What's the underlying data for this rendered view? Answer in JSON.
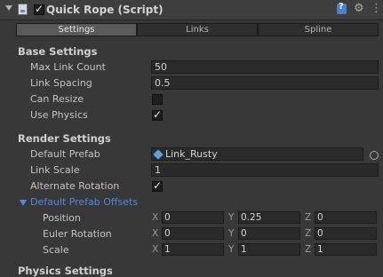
{
  "header": {
    "title": "Quick Rope (Script)",
    "enabled": true,
    "icons": [
      "script-icon",
      "help-book-icon",
      "gear-icon",
      "menu-icon"
    ]
  },
  "tabs": [
    {
      "label": "Settings",
      "active": true
    },
    {
      "label": "Links"
    },
    {
      "label": "Spline"
    }
  ],
  "base_settings": {
    "title": "Base Settings",
    "max_link_count": {
      "label": "Max Link Count",
      "value": "50"
    },
    "link_spacing": {
      "label": "Link Spacing",
      "value": "0.5"
    },
    "can_resize": {
      "label": "Can Resize",
      "checked": false
    },
    "use_physics": {
      "label": "Use Physics",
      "checked": true
    }
  },
  "render_settings": {
    "title": "Render Settings",
    "default_prefab": {
      "label": "Default Prefab",
      "value": "Link_Rusty"
    },
    "link_scale": {
      "label": "Link Scale",
      "value": "1"
    },
    "alternate_rotation": {
      "label": "Alternate Rotation",
      "checked": true
    },
    "offsets": {
      "title": "Default Prefab Offsets",
      "position": {
        "label": "Position",
        "x": "0",
        "y": "0.25",
        "z": "0"
      },
      "euler_rotation": {
        "label": "Euler Rotation",
        "x": "0",
        "y": "0",
        "z": "0"
      },
      "scale": {
        "label": "Scale",
        "x": "1",
        "y": "1",
        "z": "1"
      }
    }
  },
  "axes": {
    "x": "X",
    "y": "Y",
    "z": "Z"
  },
  "partial_section": "Physics Settings"
}
